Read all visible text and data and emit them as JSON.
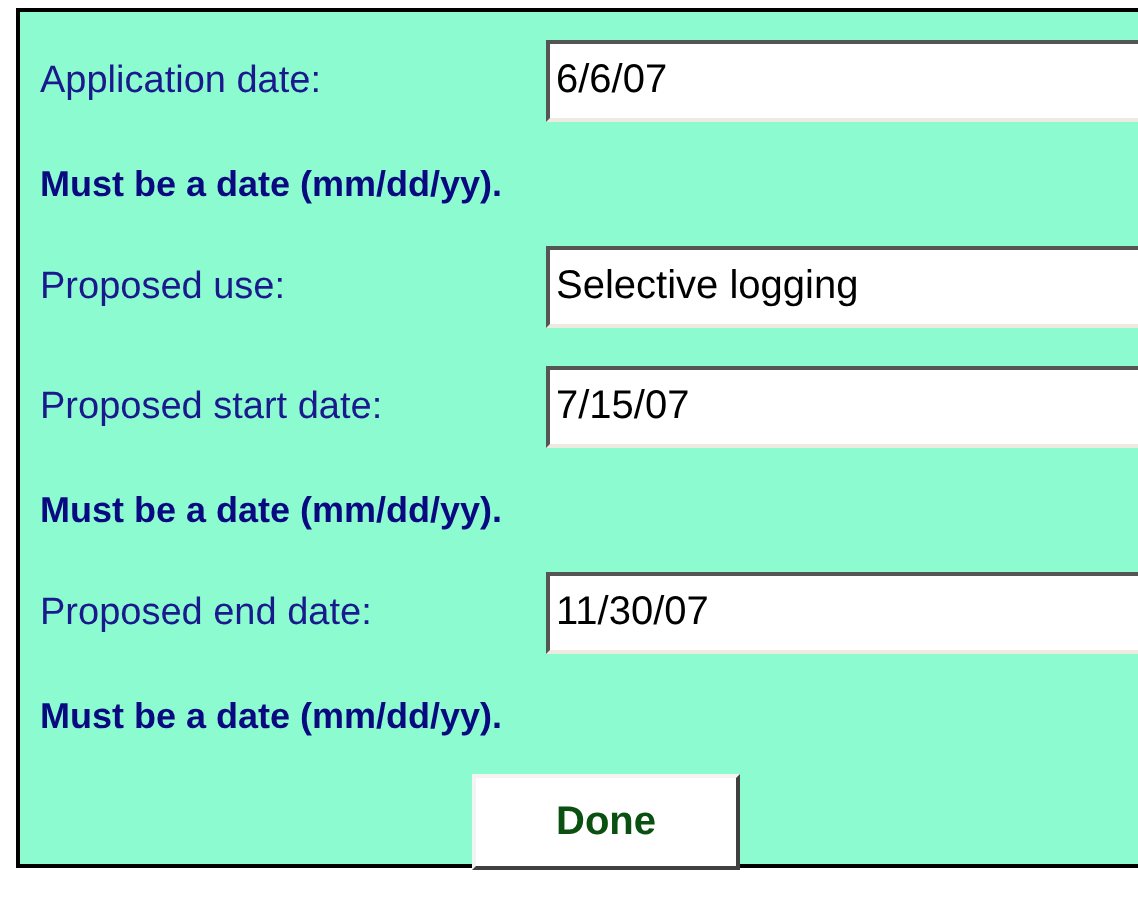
{
  "rows": [
    {
      "kind": "field",
      "label": "Application date:",
      "value": "6/6/07"
    },
    {
      "kind": "message",
      "text": "Must be a date (mm/dd/yy)."
    },
    {
      "kind": "field",
      "label": "Proposed use:",
      "value": "Selective logging"
    },
    {
      "kind": "field",
      "label": "Proposed start date:",
      "value": "7/15/07"
    },
    {
      "kind": "message",
      "text": "Must be a date (mm/dd/yy)."
    },
    {
      "kind": "field",
      "label": "Proposed end date:",
      "value": "11/30/07"
    },
    {
      "kind": "message",
      "text": "Must be a date (mm/dd/yy)."
    }
  ],
  "button": "Done"
}
